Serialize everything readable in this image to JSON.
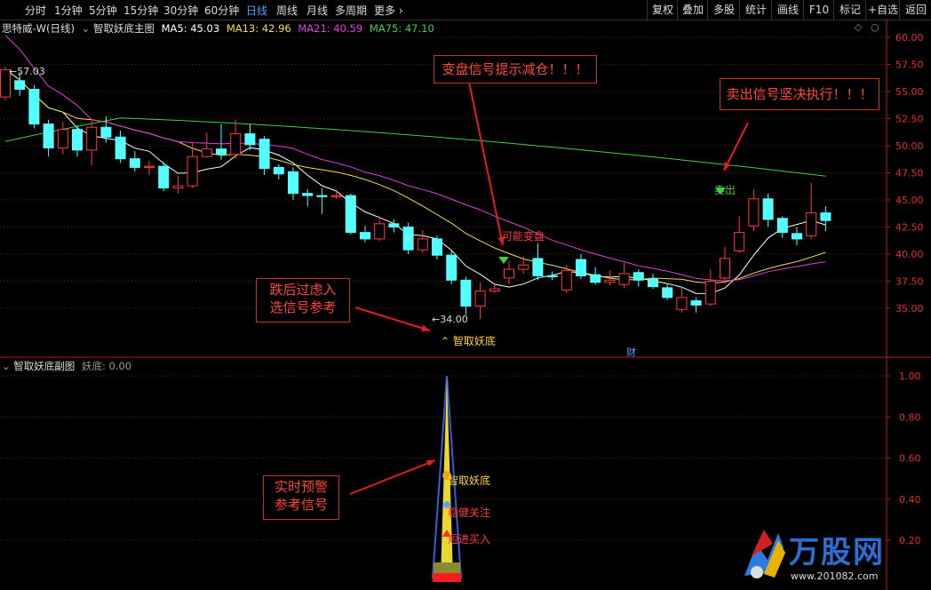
{
  "toolbar": {
    "periods": [
      "分时",
      "1分钟",
      "5分钟",
      "15分钟",
      "30分钟",
      "60分钟",
      "日线",
      "周线",
      "月线",
      "多周期",
      "更多"
    ],
    "active": "日线",
    "right_buttons": [
      "复权",
      "叠加",
      "多股",
      "统计",
      "画线",
      "F10",
      "标记",
      "+自选",
      "返回"
    ]
  },
  "main_panel": {
    "stock": "思特威-W(日线)",
    "indicator": "智取妖底主图",
    "ma_labels": [
      "MA5: 45.03",
      "MA13: 42.96",
      "MA21: 40.59",
      "MA75: 47.10"
    ],
    "ma_colors": [
      "#ffffff",
      "#f0e046",
      "#e040e0",
      "#40d040"
    ],
    "yaxis": [
      "60.00",
      "57.50",
      "55.00",
      "52.50",
      "50.00",
      "47.50",
      "45.00",
      "42.50",
      "40.00",
      "37.50",
      "35.00"
    ],
    "high_label": "57.03",
    "low_label": "34.00",
    "cai_label": "财"
  },
  "annotations": {
    "change_signal": "变盘信号提示减仓！！！",
    "sell_signal": "卖出信号坚决执行！！！",
    "dip_line1": "跌后过虑入",
    "dip_line2": "选信号参考",
    "realtime_line1": "实时预警",
    "realtime_line2": "参考信号",
    "possible_change": "可能变盘",
    "sell_mark": "卖出",
    "yaodi": "智取妖底"
  },
  "sub_panel": {
    "title": "智取妖底副图",
    "value_label": "妖底: 0.00",
    "yaxis": [
      "1.00",
      "0.80",
      "0.60",
      "0.40",
      "0.20"
    ],
    "labels": [
      "智取妖底",
      "稳健关注",
      "短进买入"
    ]
  },
  "watermark": {
    "brand": "万股网",
    "url": "www.201082.com"
  },
  "colors": {
    "up": "#ff3b3b",
    "down": "#54ffff",
    "grid": "#7a1010",
    "axis": "#c01818"
  },
  "chart_data": {
    "type": "candlestick",
    "days": 58,
    "candles": [
      [
        54.5,
        57.0,
        57.3,
        54.2
      ],
      [
        56.0,
        55.2,
        56.8,
        54.6
      ],
      [
        55.2,
        52.0,
        55.6,
        51.6
      ],
      [
        52.0,
        49.8,
        52.4,
        49.0
      ],
      [
        49.8,
        51.5,
        52.2,
        49.2
      ],
      [
        51.5,
        49.6,
        51.9,
        49.0
      ],
      [
        49.6,
        51.7,
        52.3,
        48.2
      ],
      [
        51.7,
        50.8,
        52.7,
        50.3
      ],
      [
        50.8,
        48.8,
        51.4,
        48.4
      ],
      [
        48.8,
        48.0,
        49.5,
        47.6
      ],
      [
        48.0,
        48.1,
        48.6,
        47.3
      ],
      [
        48.1,
        46.1,
        48.5,
        45.8
      ],
      [
        46.1,
        46.3,
        47.2,
        45.6
      ],
      [
        46.3,
        49.0,
        50.3,
        46.1
      ],
      [
        49.0,
        49.7,
        51.2,
        48.9
      ],
      [
        49.7,
        49.2,
        52.0,
        48.7
      ],
      [
        49.2,
        51.1,
        52.4,
        48.8
      ],
      [
        51.1,
        50.1,
        52.0,
        49.6
      ],
      [
        50.6,
        47.9,
        50.9,
        47.3
      ],
      [
        48.0,
        47.4,
        48.3,
        46.9
      ],
      [
        47.6,
        45.6,
        48.0,
        45.0
      ],
      [
        45.6,
        45.4,
        46.0,
        44.4
      ],
      [
        45.4,
        45.3,
        46.1,
        43.7
      ],
      [
        45.3,
        45.4,
        46.0,
        45.1
      ],
      [
        45.4,
        42.0,
        45.6,
        41.8
      ],
      [
        42.0,
        41.4,
        42.6,
        41.1
      ],
      [
        41.4,
        42.8,
        43.5,
        41.2
      ],
      [
        42.8,
        42.5,
        43.2,
        42.0
      ],
      [
        42.5,
        40.4,
        42.9,
        40.0
      ],
      [
        40.4,
        41.4,
        42.2,
        40.1
      ],
      [
        41.4,
        39.9,
        41.7,
        39.5
      ],
      [
        39.9,
        37.6,
        40.3,
        37.2
      ],
      [
        37.6,
        35.2,
        37.9,
        34.4
      ],
      [
        35.2,
        36.6,
        37.4,
        34.0
      ],
      [
        36.6,
        36.8,
        37.2,
        36.4
      ],
      [
        37.8,
        38.6,
        39.4,
        37.2
      ],
      [
        38.6,
        39.0,
        39.8,
        38.2
      ],
      [
        39.6,
        38.0,
        41.0,
        37.6
      ],
      [
        38.0,
        37.9,
        38.4,
        37.6
      ],
      [
        36.7,
        38.5,
        39.0,
        36.4
      ],
      [
        39.5,
        38.0,
        40.0,
        37.7
      ],
      [
        38.1,
        37.4,
        38.8,
        37.2
      ],
      [
        37.4,
        37.6,
        38.5,
        37.1
      ],
      [
        37.2,
        38.2,
        39.2,
        36.9
      ],
      [
        38.3,
        37.6,
        38.6,
        37.0
      ],
      [
        37.7,
        37.0,
        38.2,
        36.8
      ],
      [
        36.9,
        36.0,
        37.2,
        35.8
      ],
      [
        34.9,
        36.0,
        37.0,
        34.6
      ],
      [
        35.7,
        35.3,
        36.0,
        34.6
      ],
      [
        35.4,
        37.5,
        38.6,
        35.2
      ],
      [
        37.8,
        39.6,
        40.7,
        37.3
      ],
      [
        40.3,
        42.0,
        43.5,
        40.1
      ],
      [
        42.6,
        45.1,
        46.0,
        42.1
      ],
      [
        45.1,
        43.2,
        45.6,
        42.5
      ],
      [
        43.3,
        42.0,
        43.5,
        41.5
      ],
      [
        41.9,
        41.4,
        42.5,
        40.8
      ],
      [
        41.7,
        43.8,
        46.6,
        41.4
      ],
      [
        43.8,
        43.1,
        44.4,
        42.1
      ]
    ],
    "sub_values": [
      {
        "label": "智取妖底",
        "value": 1.0
      }
    ]
  }
}
